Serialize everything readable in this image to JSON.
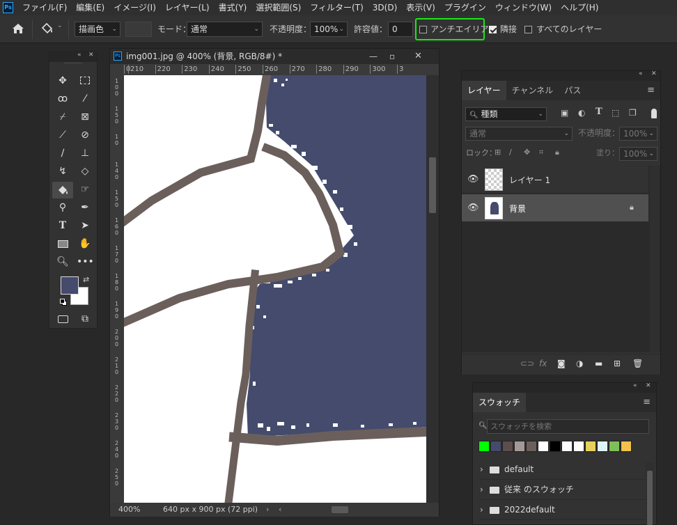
{
  "app": {
    "logo_text": "Ps"
  },
  "menu": [
    "ファイル(F)",
    "編集(E)",
    "イメージ(I)",
    "レイヤー(L)",
    "書式(Y)",
    "選択範囲(S)",
    "フィルター(T)",
    "3D(D)",
    "表示(V)",
    "プラグイン",
    "ウィンドウ(W)",
    "ヘルプ(H)"
  ],
  "options": {
    "fill_source": "描画色",
    "mode_label": "モード：",
    "mode_value": "通常",
    "opacity_label": "不透明度：",
    "opacity_value": "100%",
    "tolerance_label": "許容値：",
    "tolerance_value": "0",
    "antialias_label": "アンチエイリアス",
    "antialias_checked": false,
    "contiguous_label": "隣接",
    "contiguous_checked": true,
    "all_layers_label": "すべてのレイヤー",
    "all_layers_checked": false,
    "highlight_color": "#19e619"
  },
  "toolbox": {
    "fg_color": "#444b6d",
    "bg_color": "#ffffff"
  },
  "document": {
    "title": "img001.jpg @ 400% (背景, RGB/8#) *",
    "ruler_ticks": [
      "0",
      "210",
      "220",
      "230",
      "240",
      "250",
      "260",
      "270",
      "280",
      "290",
      "300",
      "3"
    ],
    "vruler_ticks": [
      "1\n0\n0",
      "1\n5\n0",
      "1\n0",
      "1\n4\n0",
      "1\n5\n0",
      "1\n6\n0",
      "1\n7\n0",
      "1\n8\n0",
      "1\n9\n0",
      "2\n0\n0",
      "2\n1\n0",
      "2\n2\n0",
      "2\n3\n0",
      "2\n4\n0",
      "2\n5\n0"
    ],
    "zoom": "400%",
    "doc_info": "640 px x 900 px (72 ppi)",
    "canvas_fill": "#444b6d",
    "line_color": "#6b5f5c"
  },
  "layers_panel": {
    "tabs": [
      "レイヤー",
      "チャンネル",
      "パス"
    ],
    "filter_kind": "種類",
    "blend_mode": "通常",
    "opacity_label": "不透明度：",
    "opacity_value": "100%",
    "lock_label": "ロック：",
    "fill_label": "塗り：",
    "fill_value": "100%",
    "layers": [
      {
        "name": "レイヤー 1",
        "visible": true,
        "locked": false,
        "selected": false
      },
      {
        "name": "背景",
        "visible": true,
        "locked": true,
        "selected": true
      }
    ]
  },
  "swatches_panel": {
    "tab": "スウォッチ",
    "search_placeholder": "スウォッチを検索",
    "recent_colors": [
      "#00ff00",
      "#444b6d",
      "#5d4e4b",
      "#a39a98",
      "#6b5f5c",
      "#ffffff",
      "#000000",
      "#ffffff",
      "#ffffff",
      "#e7d15a",
      "#dff4f4",
      "#7fbf5a",
      "#f2c24a"
    ],
    "folders": [
      "default",
      "従来 のスウォッチ",
      "2022default"
    ]
  }
}
